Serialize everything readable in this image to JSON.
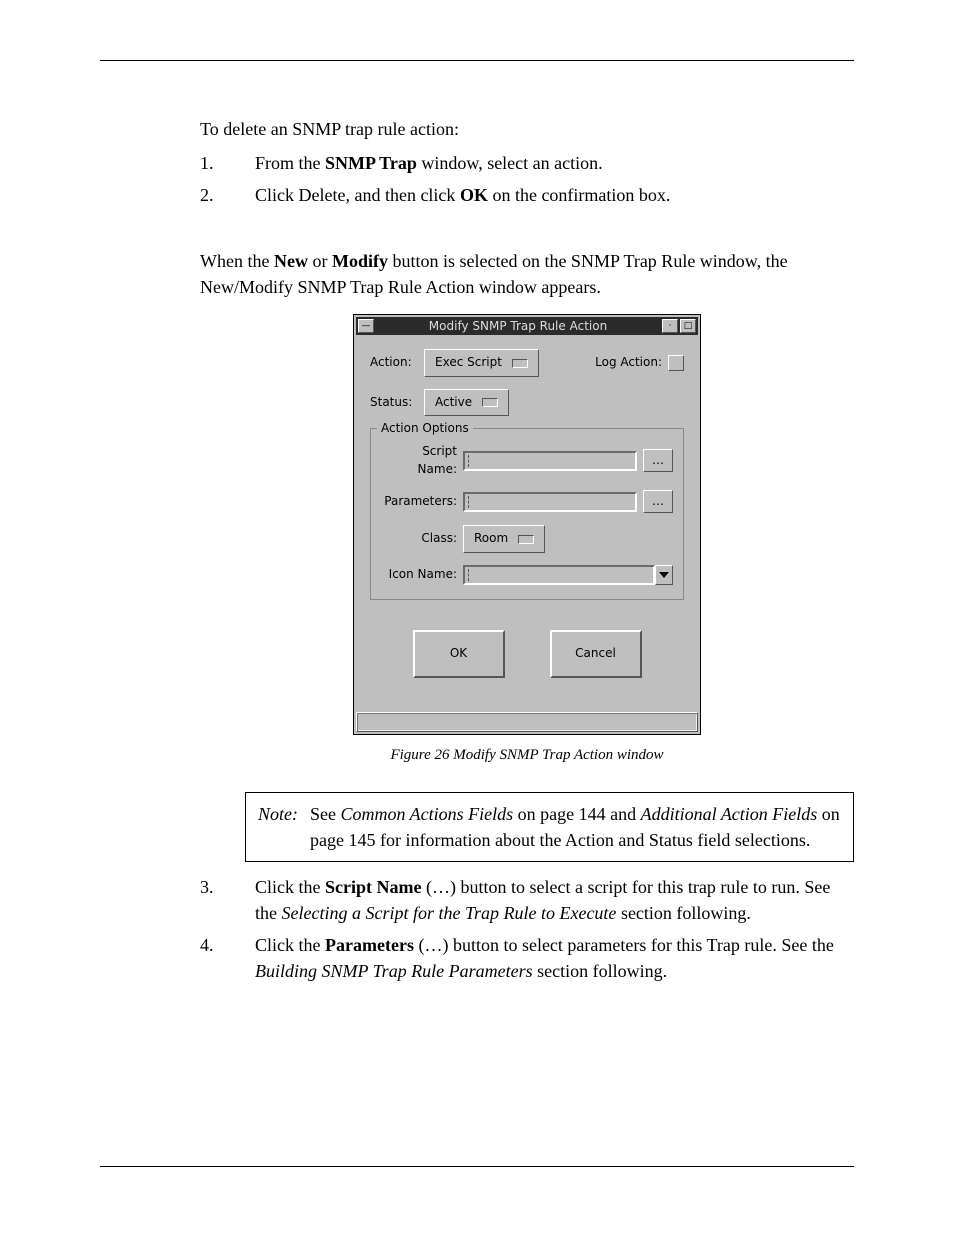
{
  "intro": "To delete an SNMP trap rule action:",
  "steps_a": [
    {
      "num": "1.",
      "pre": "From the ",
      "bold": "SNMP Trap",
      "post": " window, select an action."
    },
    {
      "num": "2.",
      "pre": "Click Delete, and then click ",
      "bold": "OK",
      "post": " on the confirmation box."
    }
  ],
  "mid_para": {
    "pre": "When the ",
    "b1": "New",
    "mid1": " or ",
    "b2": "Modify",
    "post": " button is selected on the SNMP Trap Rule window, the New/Modify SNMP Trap Rule Action window appears."
  },
  "dialog": {
    "title": "Modify SNMP Trap Rule Action",
    "action_label": "Action:",
    "action_value": "Exec Script",
    "log_action_label": "Log Action:",
    "status_label": "Status:",
    "status_value": "Active",
    "fieldset_legend": "Action Options",
    "script_name_label": "Script Name:",
    "parameters_label": "Parameters:",
    "class_label": "Class:",
    "class_value": "Room",
    "icon_name_label": "Icon Name:",
    "ellipsis": "…",
    "ok": "OK",
    "cancel": "Cancel"
  },
  "caption": "Figure 26 Modify SNMP Trap Action window",
  "note": {
    "label": "Note:",
    "pre": "See ",
    "i1": "Common Actions Fields",
    "mid1": " on page 144 and ",
    "i2": "Additional Action Fields",
    "post": " on page 145 for information about the Action and Status field selections."
  },
  "steps_b": [
    {
      "num": "3.",
      "pre": "Click the ",
      "bold": "Script Name",
      "mid": " (…) button to select a script for this trap rule to run. See the ",
      "ital": "Selecting a Script for the Trap Rule to Execute",
      "post": " section following."
    },
    {
      "num": "4.",
      "pre": "Click the ",
      "bold": "Parameters",
      "mid": " (…) button to select parameters for this Trap rule. See the ",
      "ital": "Building SNMP Trap Rule Parameters",
      "post": " section following."
    }
  ]
}
